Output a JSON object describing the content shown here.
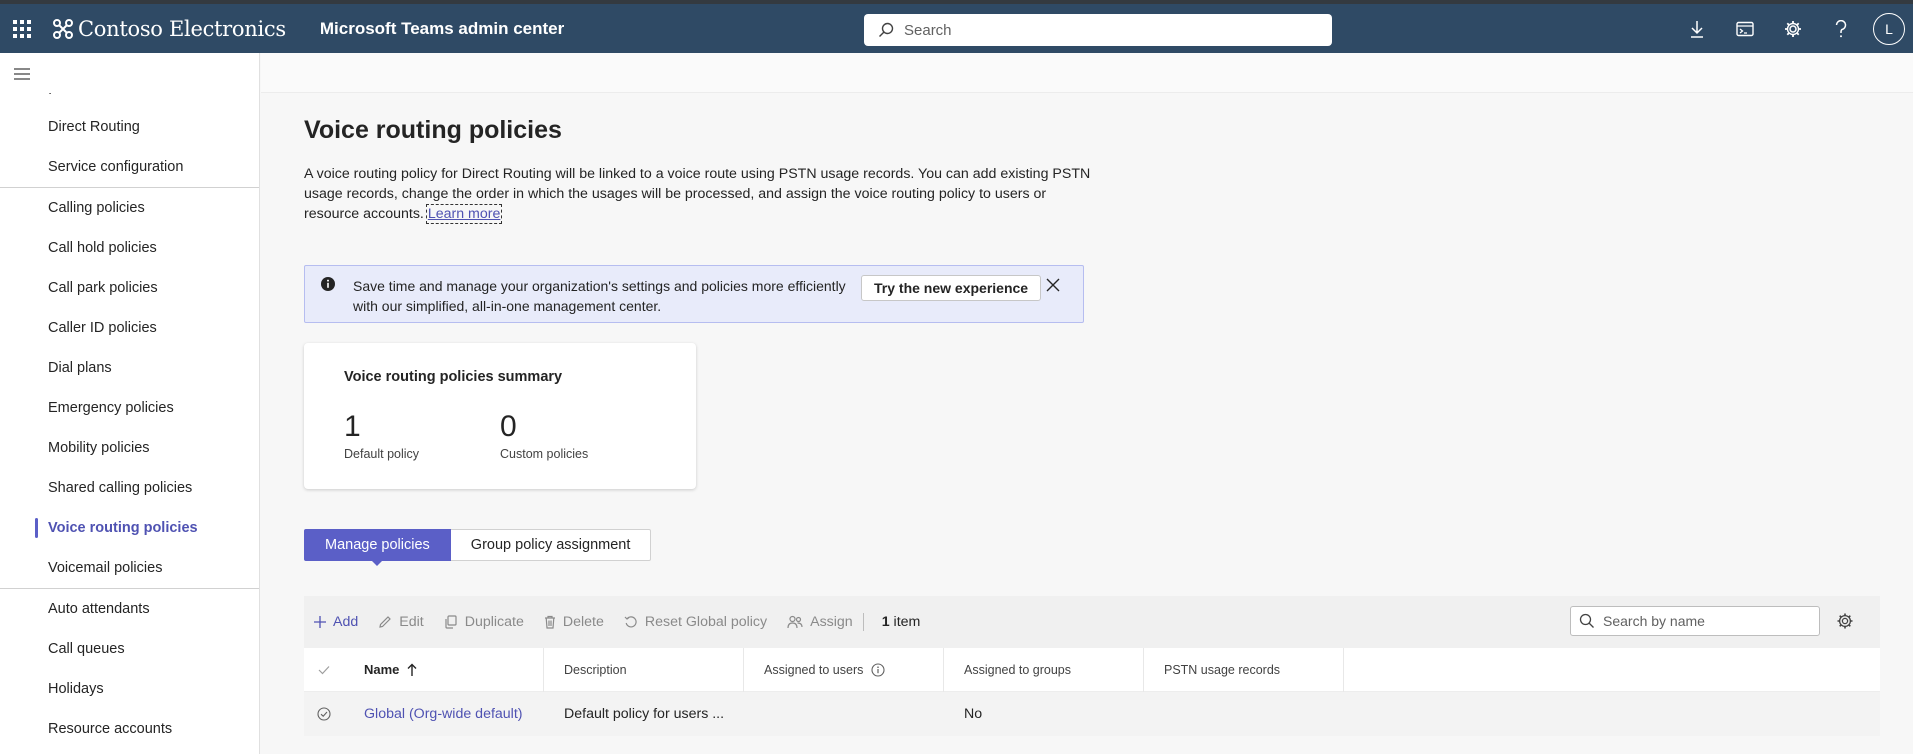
{
  "topbar": {
    "brand": "Contoso Electronics",
    "app_title": "Microsoft Teams admin center",
    "search_placeholder": "Search",
    "avatar_initial": "L"
  },
  "sidebar": {
    "groups": [
      {
        "items": [
          {
            "label": "Direct Routing"
          },
          {
            "label": "Service configuration"
          }
        ]
      },
      {
        "items": [
          {
            "label": "Calling policies"
          },
          {
            "label": "Call hold policies"
          },
          {
            "label": "Call park policies"
          },
          {
            "label": "Caller ID policies"
          },
          {
            "label": "Dial plans"
          },
          {
            "label": "Emergency policies"
          },
          {
            "label": "Mobility policies"
          },
          {
            "label": "Shared calling policies"
          },
          {
            "label": "Voice routing policies",
            "active": true
          },
          {
            "label": "Voicemail policies"
          }
        ]
      },
      {
        "items": [
          {
            "label": "Auto attendants"
          },
          {
            "label": "Call queues"
          },
          {
            "label": "Holidays"
          },
          {
            "label": "Resource accounts"
          }
        ]
      }
    ]
  },
  "page": {
    "title": "Voice routing policies",
    "description": "A voice routing policy for Direct Routing will be linked to a voice route using PSTN usage records. You can add existing PSTN usage records, change the order in which the usages will be processed, and assign the voice routing policy to users or resource accounts. ",
    "learn_more": "Learn more"
  },
  "banner": {
    "text": "Save time and manage your organization's settings and policies more efficiently with our simplified, all-in-one management center.",
    "button": "Try the new experience"
  },
  "summary": {
    "title": "Voice routing policies summary",
    "stats": [
      {
        "value": "1",
        "label": "Default policy"
      },
      {
        "value": "0",
        "label": "Custom policies"
      }
    ]
  },
  "tabs": [
    {
      "label": "Manage policies",
      "active": true
    },
    {
      "label": "Group policy assignment"
    }
  ],
  "toolbar": {
    "add": "Add",
    "edit": "Edit",
    "duplicate": "Duplicate",
    "delete": "Delete",
    "reset": "Reset Global policy",
    "assign": "Assign",
    "count": "1",
    "count_label": "item",
    "search_placeholder": "Search by name"
  },
  "table": {
    "columns": [
      "Name",
      "Description",
      "Assigned to users",
      "Assigned to groups",
      "PSTN usage records"
    ],
    "rows": [
      {
        "name": "Global (Org-wide default)",
        "description": "Default policy for users ...",
        "assigned_users": "",
        "assigned_groups": "No",
        "pstn": ""
      }
    ]
  }
}
